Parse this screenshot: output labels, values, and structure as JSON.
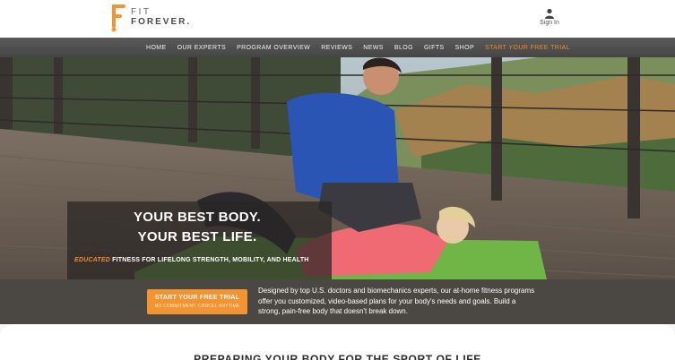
{
  "brand": {
    "name_line1": "FIT",
    "name_line2": "FOREVER.",
    "accent_color": "#f39433"
  },
  "header": {
    "signin_label": "Sign In",
    "signin_icon": "user-icon"
  },
  "nav": {
    "items": [
      "HOME",
      "OUR EXPERTS",
      "PROGRAM OVERVIEW",
      "REVIEWS",
      "NEWS",
      "BLOG",
      "GIFTS",
      "SHOP"
    ],
    "highlight_item": "START YOUR FREE TRIAL"
  },
  "hero": {
    "line1": "YOUR BEST BODY.",
    "line2": "YOUR BEST LIFE.",
    "sub_accent": "EDUCATED",
    "sub_rest": " FITNESS FOR LIFELONG STRENGTH, MOBILITY, AND HEALTH"
  },
  "promo": {
    "cta_label": "START YOUR FREE TRIAL",
    "cta_sub": "NO COMMITMENT. CANCEL ANYTIME",
    "description": "Designed by top U.S. doctors and biomechanics experts, our at-home fitness programs offer you customized, video-based plans for your body's needs and goals. Build a strong, pain-free body that doesn't break down."
  },
  "section": {
    "title": "PREPARING YOUR BODY FOR THE SPORT OF LIFE"
  }
}
